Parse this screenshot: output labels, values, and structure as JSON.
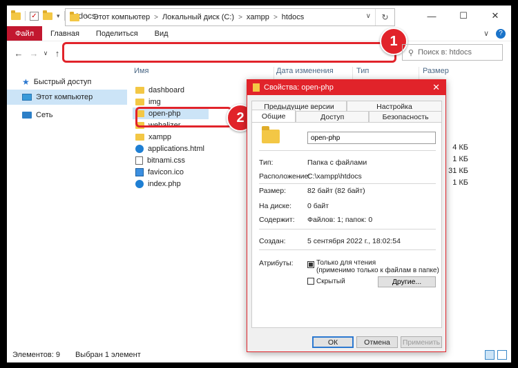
{
  "window": {
    "title": "htdocs",
    "controls": [
      "—",
      "☐",
      "✕"
    ]
  },
  "ribbon": {
    "file": "Файл",
    "tabs": [
      "Главная",
      "Поделиться",
      "Вид"
    ],
    "chevron": "∨",
    "help": "?"
  },
  "nav": {
    "back": "←",
    "forward": "→",
    "recent": "∨",
    "up": "↑"
  },
  "address": {
    "crumbs": [
      "Этот компьютер",
      "Локальный диск (C:)",
      "xampp",
      "htdocs"
    ],
    "sep": ">",
    "dropdown": "∨",
    "refresh": "↻"
  },
  "search": {
    "placeholder": "Поиск в: htdocs",
    "icon": "⚲"
  },
  "badges": {
    "one": "1",
    "two": "2"
  },
  "sidebar": {
    "items": [
      {
        "label": "Быстрый доступ",
        "icon": "star-icon"
      },
      {
        "label": "Этот компьютер",
        "icon": "computer-icon"
      },
      {
        "label": "Сеть",
        "icon": "network-icon"
      }
    ]
  },
  "columns": {
    "name": "Имя",
    "date": "Дата изменения",
    "type": "Тип",
    "size": "Размер"
  },
  "files": [
    {
      "name": "dashboard",
      "kind": "folder"
    },
    {
      "name": "img",
      "kind": "folder"
    },
    {
      "name": "open-php",
      "kind": "folder"
    },
    {
      "name": "webalizer",
      "kind": "folder"
    },
    {
      "name": "xampp",
      "kind": "folder"
    },
    {
      "name": "applications.html",
      "kind": "edge",
      "size": "4 КБ"
    },
    {
      "name": "bitnami.css",
      "kind": "css",
      "size": "1 КБ"
    },
    {
      "name": "favicon.ico",
      "kind": "ico",
      "size": "31 КБ"
    },
    {
      "name": "index.php",
      "kind": "edge",
      "size": "1 КБ"
    }
  ],
  "status": {
    "count": "Элементов: 9",
    "selected": "Выбран 1 элемент"
  },
  "dialog": {
    "title": "Свойства: open-php",
    "close": "✕",
    "tabs_row1": [
      "Предыдущие версии",
      "Настройка"
    ],
    "tabs_row2": [
      "Общие",
      "Доступ",
      "Безопасность"
    ],
    "name_value": "open-php",
    "props": [
      {
        "label": "Тип:",
        "value": "Папка с файлами"
      },
      {
        "label": "Расположение:",
        "value": "C:\\xampp\\htdocs"
      },
      {
        "label": "Размер:",
        "value": "82 байт (82 байт)"
      },
      {
        "label": "На диске:",
        "value": "0 байт"
      },
      {
        "label": "Содержит:",
        "value": "Файлов: 1; папок: 0"
      },
      {
        "label": "Создан:",
        "value": "5 сентября 2022 г., 18:02:54"
      }
    ],
    "attributes_label": "Атрибуты:",
    "readonly_line1": "Только для чтения",
    "readonly_line2": "(применимо только к файлам в папке)",
    "hidden": "Скрытый",
    "other_button": "Другие...",
    "ok": "ОК",
    "cancel": "Отмена",
    "apply": "Применить"
  },
  "colors": {
    "accent_red": "#e1232a",
    "file_tab": "#c2172f",
    "selection": "#cce4f7",
    "folder": "#f3c745"
  }
}
